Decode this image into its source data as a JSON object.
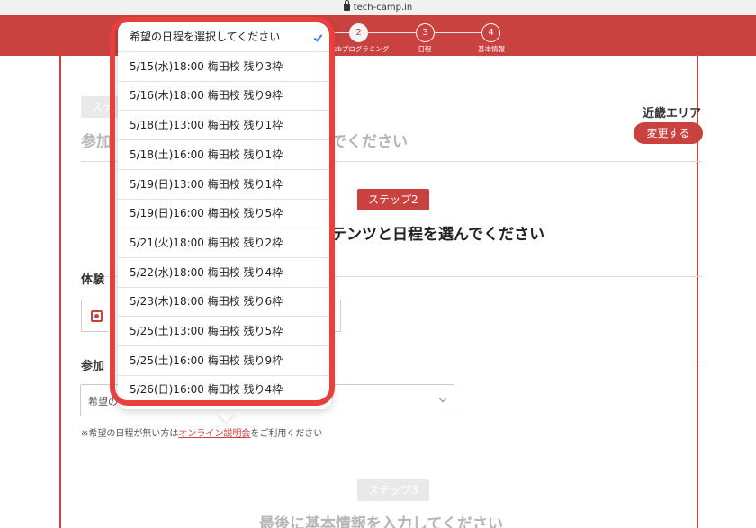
{
  "browser": {
    "url": "tech-camp.in"
  },
  "progress": {
    "steps": [
      {
        "number": "2",
        "label": "Webプログラミング"
      },
      {
        "number": "3",
        "label": "日程"
      },
      {
        "number": "4",
        "label": "基本情報"
      }
    ]
  },
  "step1": {
    "badge": "ステ",
    "heading_left": "参加",
    "heading_right": "でください"
  },
  "region": {
    "name": "近畿エリア",
    "change_label": "変更する"
  },
  "step2": {
    "badge": "ステップ2",
    "heading": "テンツと日程を選んでください"
  },
  "experience": {
    "label": "体験"
  },
  "participation": {
    "label": "参加",
    "select_value": "希望の"
  },
  "note": {
    "prefix": "※希望の日程が無い方は",
    "link": "オンライン説明会",
    "suffix": "をご利用ください"
  },
  "step3": {
    "badge": "ステップ3",
    "heading": "最後に基本情報を入力してください"
  },
  "dropdown": {
    "placeholder": "希望の日程を選択してください",
    "options": [
      "5/15(水)18:00 梅田校 残り3枠",
      "5/16(木)18:00 梅田校 残り9枠",
      "5/18(土)13:00 梅田校 残り1枠",
      "5/18(土)16:00 梅田校 残り1枠",
      "5/19(日)13:00 梅田校 残り1枠",
      "5/19(日)16:00 梅田校 残り5枠",
      "5/21(火)18:00 梅田校 残り2枠",
      "5/22(水)18:00 梅田校 残り4枠",
      "5/23(木)18:00 梅田校 残り6枠",
      "5/25(土)13:00 梅田校 残り5枠",
      "5/25(土)16:00 梅田校 残り9枠",
      "5/26(日)16:00 梅田校 残り4枠"
    ]
  },
  "colors": {
    "brand": "#c9423f",
    "highlight": "#e8403f",
    "check": "#3478f6"
  }
}
